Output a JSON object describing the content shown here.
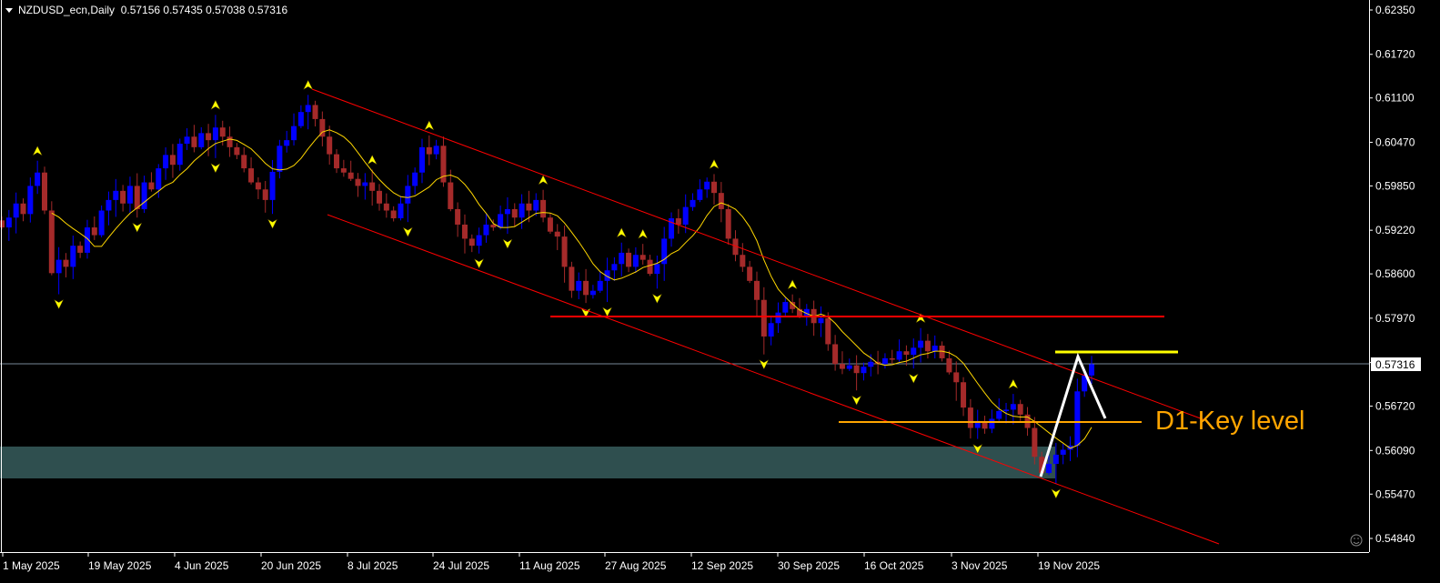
{
  "header": {
    "symbol": "NZDUSD_ecn,Daily",
    "ohlc": "0.57156 0.57435 0.57038 0.57316"
  },
  "annotation": "D1-Key level",
  "chart_data": {
    "type": "candlestick",
    "title": "NZDUSD_ecn,Daily",
    "ylim": [
      0.5484,
      0.6235
    ],
    "y_ticks": [
      "0.62350",
      "0.61720",
      "0.61100",
      "0.60470",
      "0.59850",
      "0.59220",
      "0.58600",
      "0.57970",
      "0.57340",
      "0.56720",
      "0.56090",
      "0.55470",
      "0.54840"
    ],
    "current_price": "0.57316",
    "x_ticks": [
      "1 May 2025",
      "19 May 2025",
      "4 Jun 2025",
      "20 Jun 2025",
      "8 Jul 2025",
      "24 Jul 2025",
      "11 Aug 2025",
      "27 Aug 2025",
      "12 Sep 2025",
      "30 Sep 2025",
      "16 Oct 2025",
      "3 Nov 2025",
      "19 Nov 2025"
    ],
    "last_bar": {
      "open": 0.57156,
      "high": 0.57435,
      "low": 0.57038,
      "close": 0.57316
    },
    "closes": [
      0.5926,
      0.594,
      0.596,
      0.5945,
      0.5985,
      0.6004,
      0.595,
      0.5861,
      0.588,
      0.587,
      0.59,
      0.589,
      0.5926,
      0.5915,
      0.595,
      0.5965,
      0.5978,
      0.596,
      0.5985,
      0.5952,
      0.599,
      0.598,
      0.601,
      0.6029,
      0.6015,
      0.6045,
      0.6055,
      0.604,
      0.606,
      0.605,
      0.6068,
      0.6055,
      0.604,
      0.6029,
      0.601,
      0.599,
      0.598,
      0.5965,
      0.6005,
      0.6042,
      0.605,
      0.607,
      0.609,
      0.61,
      0.608,
      0.6055,
      0.603,
      0.601,
      0.6004,
      0.5995,
      0.5985,
      0.599,
      0.5978,
      0.596,
      0.595,
      0.5939,
      0.596,
      0.5985,
      0.6004,
      0.604,
      0.603,
      0.6042,
      0.599,
      0.5952,
      0.593,
      0.591,
      0.59,
      0.5915,
      0.593,
      0.5926,
      0.5945,
      0.5952,
      0.594,
      0.596,
      0.595,
      0.5965,
      0.594,
      0.592,
      0.5913,
      0.587,
      0.5836,
      0.585,
      0.583,
      0.5836,
      0.585,
      0.5865,
      0.5874,
      0.589,
      0.587,
      0.5887,
      0.588,
      0.586,
      0.5874,
      0.591,
      0.5939,
      0.593,
      0.5955,
      0.5965,
      0.598,
      0.5991,
      0.5975,
      0.5952,
      0.591,
      0.5887,
      0.587,
      0.585,
      0.5823,
      0.5771,
      0.579,
      0.5805,
      0.582,
      0.581,
      0.58,
      0.581,
      0.579,
      0.5797,
      0.576,
      0.5732,
      0.5725,
      0.573,
      0.5719,
      0.5728,
      0.5735,
      0.5732,
      0.574,
      0.5738,
      0.575,
      0.5745,
      0.5755,
      0.5765,
      0.575,
      0.5758,
      0.574,
      0.572,
      0.5706,
      0.567,
      0.5641,
      0.565,
      0.564,
      0.5654,
      0.5665,
      0.5667,
      0.5675,
      0.566,
      0.5641,
      0.56,
      0.5577,
      0.559,
      0.5603,
      0.561,
      0.5616,
      0.5693,
      0.57156,
      0.57316
    ],
    "colors": {
      "bull": "#0000ff",
      "bear": "#a52a2a",
      "ma": "#ffd700",
      "channel": "#ff0000",
      "key_level": "#ffa500",
      "zone": "#2f4f4f",
      "fractal": "#ffff00"
    }
  }
}
